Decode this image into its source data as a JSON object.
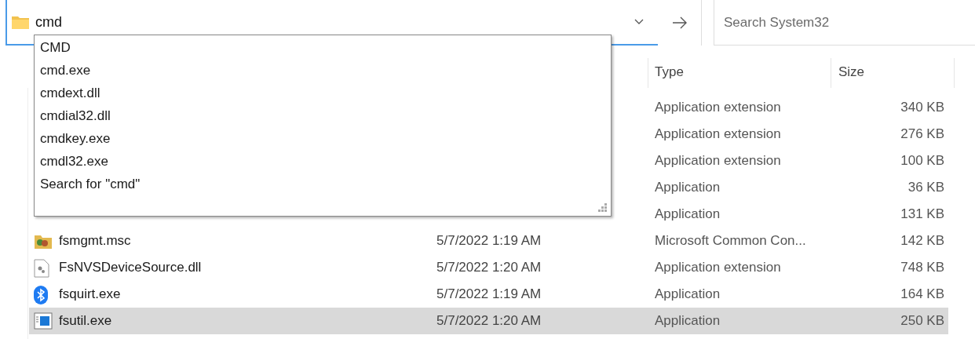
{
  "address_bar": {
    "value": "cmd"
  },
  "search": {
    "placeholder": "Search System32"
  },
  "autocomplete": {
    "items": [
      "CMD",
      "cmd.exe",
      "cmdext.dll",
      "cmdial32.dll",
      "cmdkey.exe",
      "cmdl32.exe",
      "Search for \"cmd\""
    ]
  },
  "table": {
    "columns": [
      "Type",
      "Size"
    ],
    "rows": [
      {
        "type": "Application extension",
        "size": "340 KB",
        "selected": false
      },
      {
        "type": "Application extension",
        "size": "276 KB",
        "selected": false
      },
      {
        "type": "Application extension",
        "size": "100 KB",
        "selected": false
      },
      {
        "type": "Application",
        "size": "36 KB",
        "selected": false
      },
      {
        "type": "Application",
        "size": "131 KB",
        "selected": false
      },
      {
        "kind": "msc",
        "name": "fsmgmt.msc",
        "date": "5/7/2022 1:19 AM",
        "type": "Microsoft Common Con...",
        "size": "142 KB",
        "selected": false
      },
      {
        "kind": "dll",
        "name": "FsNVSDeviceSource.dll",
        "date": "5/7/2022 1:20 AM",
        "type": "Application extension",
        "size": "748 KB",
        "selected": false
      },
      {
        "kind": "bluetooth",
        "name": "fsquirt.exe",
        "date": "5/7/2022 1:19 AM",
        "type": "Application",
        "size": "164 KB",
        "selected": false
      },
      {
        "kind": "app",
        "name": "fsutil.exe",
        "date": "5/7/2022 1:20 AM",
        "type": "Application",
        "size": "250 KB",
        "selected": true
      }
    ]
  }
}
